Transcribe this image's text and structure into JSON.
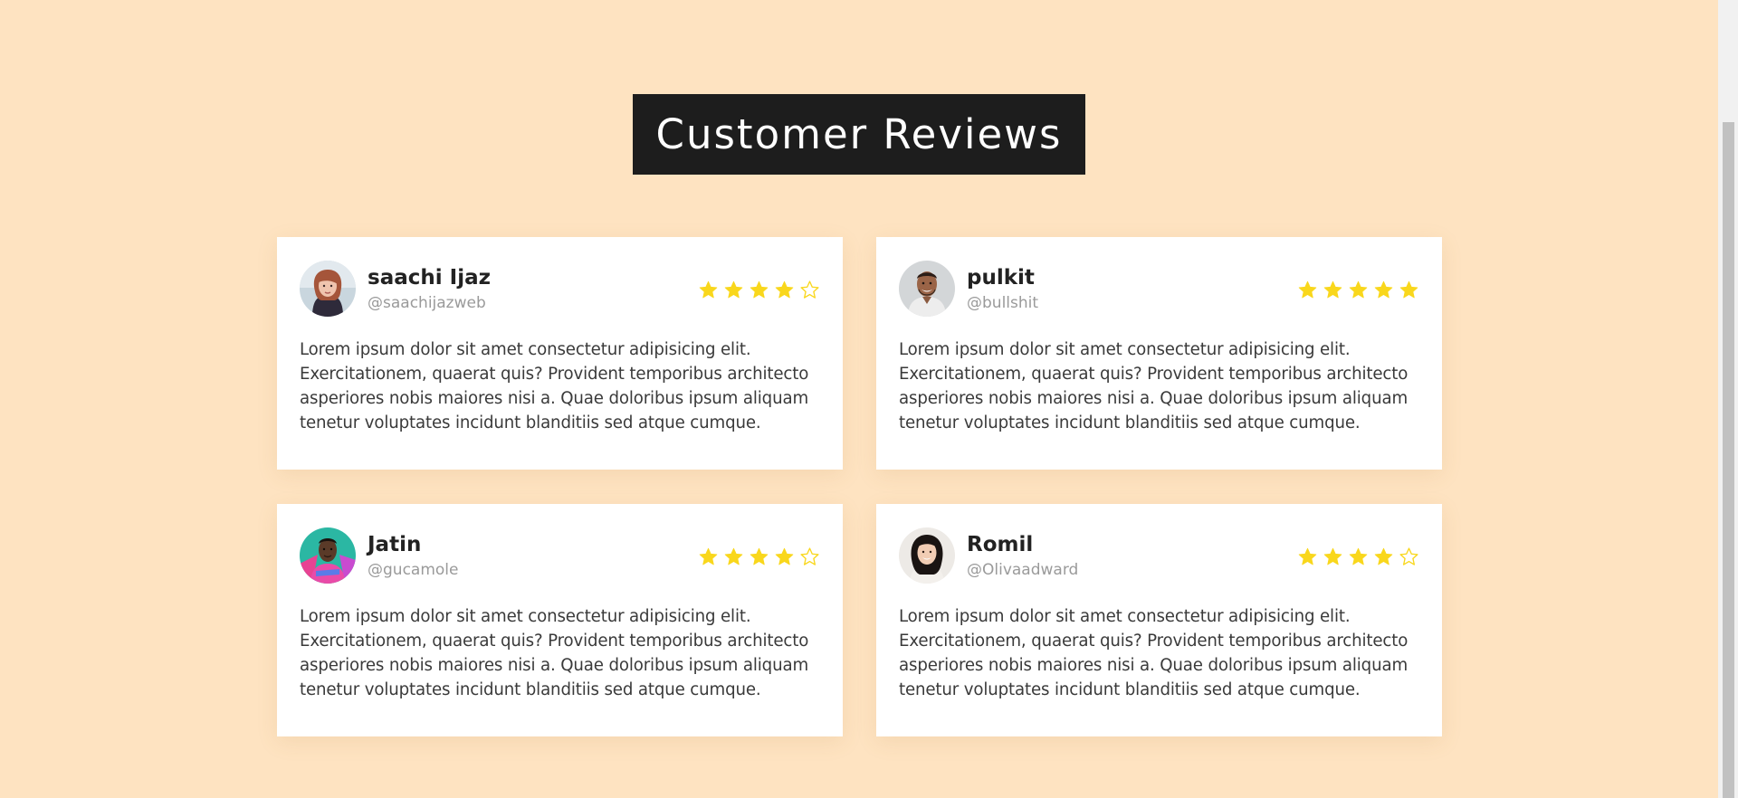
{
  "title": "Customer Reviews",
  "colors": {
    "background": "#FEE3C1",
    "heading_bg": "#1D1D1D",
    "star": "#F9D71C",
    "card": "#FFFFFF"
  },
  "reviews": [
    {
      "name": "saachi Ijaz",
      "handle": "@saachijazweb",
      "rating": 4,
      "avatar": "woman-avatar",
      "text": "Lorem ipsum dolor sit amet consectetur adipisicing elit. Exercitationem, quaerat quis? Provident temporibus architecto asperiores nobis maiores nisi a. Quae doloribus ipsum aliquam tenetur voluptates incidunt blanditiis sed atque cumque."
    },
    {
      "name": "pulkit",
      "handle": "@bullshit",
      "rating": 5,
      "avatar": "man-avatar",
      "text": "Lorem ipsum dolor sit amet consectetur adipisicing elit. Exercitationem, quaerat quis? Provident temporibus architecto asperiores nobis maiores nisi a. Quae doloribus ipsum aliquam tenetur voluptates incidunt blanditiis sed atque cumque."
    },
    {
      "name": "Jatin",
      "handle": "@gucamole",
      "rating": 4,
      "avatar": "man-avatar-colorful",
      "text": "Lorem ipsum dolor sit amet consectetur adipisicing elit. Exercitationem, quaerat quis? Provident temporibus architecto asperiores nobis maiores nisi a. Quae doloribus ipsum aliquam tenetur voluptates incidunt blanditiis sed atque cumque."
    },
    {
      "name": "Romil",
      "handle": "@Olivaadward",
      "rating": 4,
      "avatar": "woman-avatar-smiling",
      "text": "Lorem ipsum dolor sit amet consectetur adipisicing elit. Exercitationem, quaerat quis? Provident temporibus architecto asperiores nobis maiores nisi a. Quae doloribus ipsum aliquam tenetur voluptates incidunt blanditiis sed atque cumque."
    }
  ]
}
